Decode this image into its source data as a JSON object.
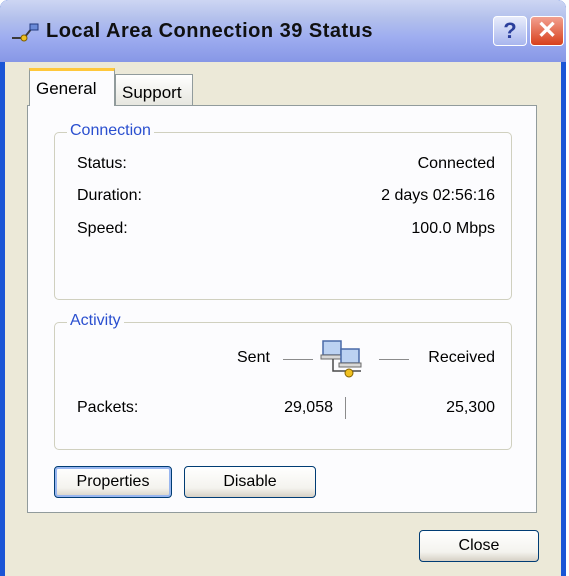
{
  "window": {
    "title": "Local Area Connection 39 Status"
  },
  "titlebar_buttons": {
    "help": "?",
    "close": "✕"
  },
  "tabs": [
    {
      "label": "General"
    },
    {
      "label": "Support"
    }
  ],
  "connection": {
    "heading": "Connection",
    "rows": [
      {
        "label": "Status:",
        "value": "Connected"
      },
      {
        "label": "Duration:",
        "value": "2 days 02:56:16"
      },
      {
        "label": "Speed:",
        "value": "100.0 Mbps"
      }
    ]
  },
  "activity": {
    "heading": "Activity",
    "sent_label": "Sent",
    "received_label": "Received",
    "packets_label": "Packets:",
    "packets_sent": "29,058",
    "packets_received": "25,300"
  },
  "buttons": {
    "properties": {
      "label": "Properties"
    },
    "disable": {
      "label": "Disable"
    },
    "close": {
      "label": "Close"
    }
  },
  "colors": {
    "titlebar": "#9eadf0",
    "accent": "#2a4fcf",
    "tab_highlight": "#ffc83c"
  },
  "icons": {
    "title": "network-connection-icon",
    "activity": "network-computers-icon"
  }
}
